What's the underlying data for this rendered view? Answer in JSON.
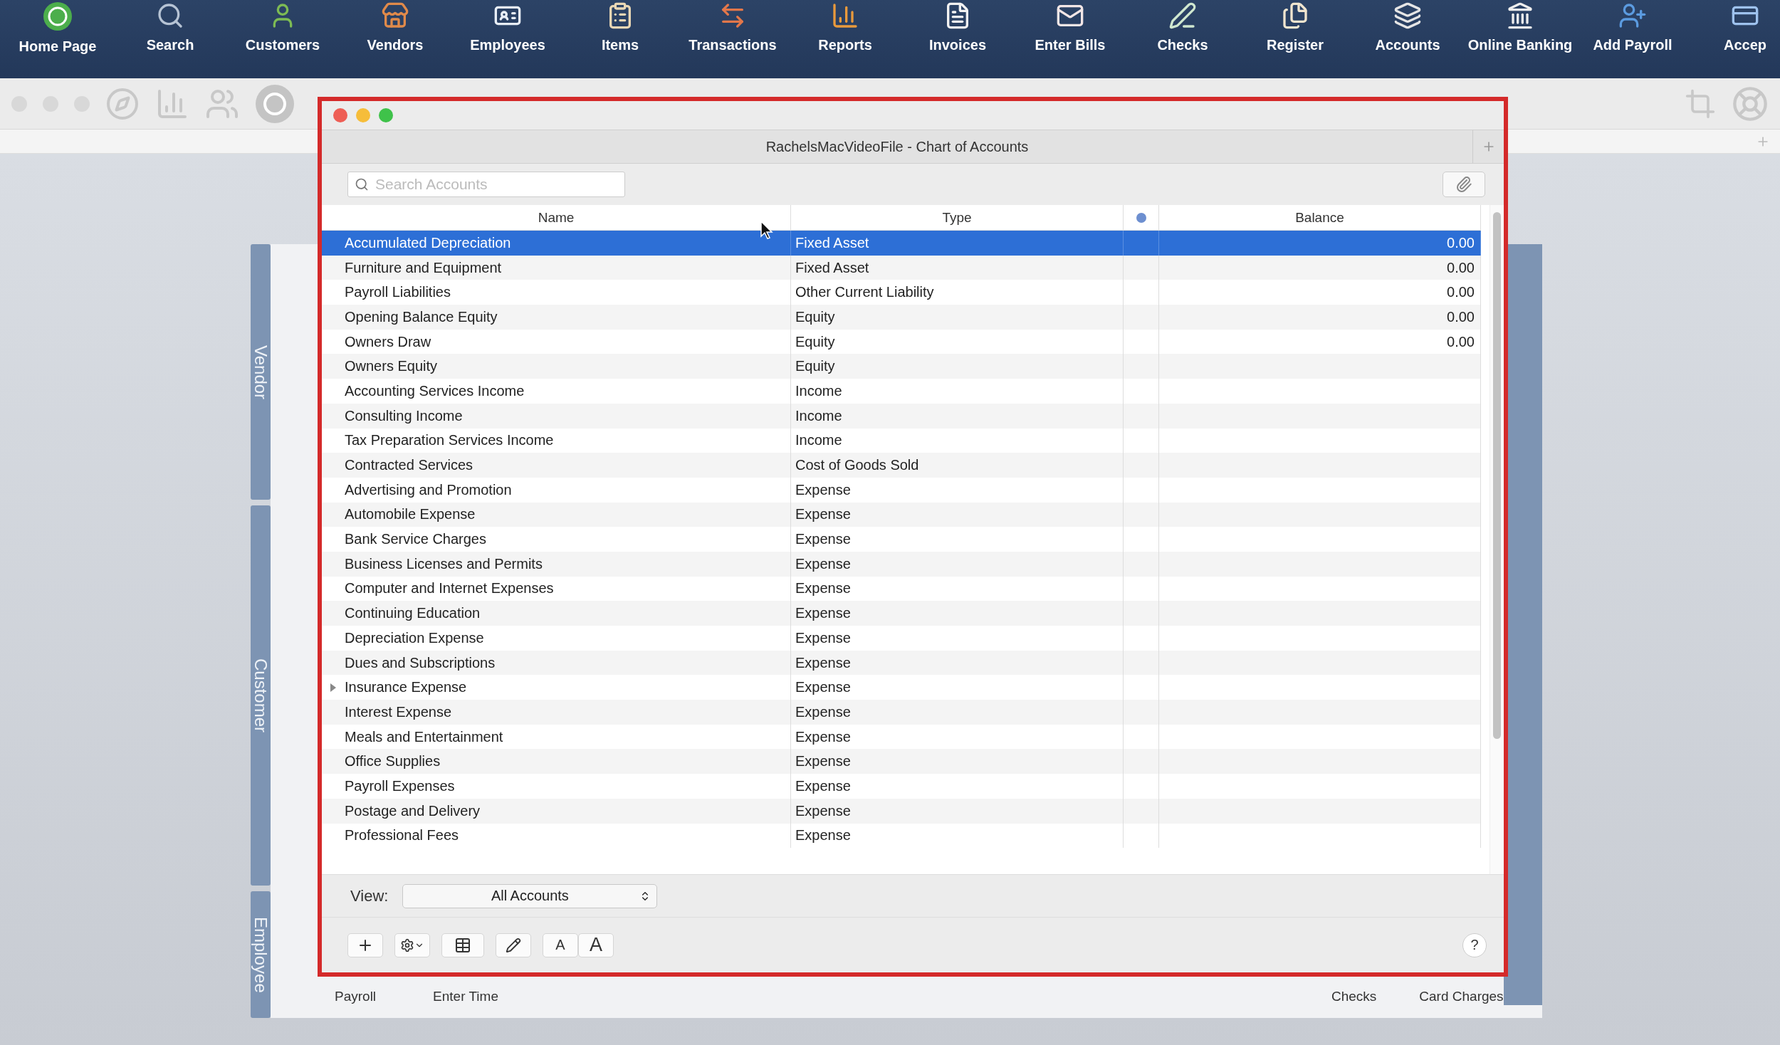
{
  "toolbar": [
    "Home Page",
    "Search",
    "Customers",
    "Vendors",
    "Employees",
    "Items",
    "Transactions",
    "Reports",
    "Invoices",
    "Enter Bills",
    "Checks",
    "Register",
    "Accounts",
    "Online Banking",
    "Add Payroll",
    "Accep"
  ],
  "side_tabs": [
    "Vendor",
    "Customer",
    "Employee"
  ],
  "shortcuts": [
    "Payroll",
    "Enter Time",
    "Checks",
    "Card Charges"
  ],
  "window": {
    "title": "RachelsMacVideoFile - Chart of Accounts",
    "search": {
      "placeholder": "Search Accounts"
    },
    "columns": [
      "Name",
      "Type",
      "Balance"
    ],
    "rows": [
      {
        "kind": "account",
        "name": "Accumulated Depreciation",
        "type": "Fixed Asset",
        "balance": "0.00",
        "selected": true
      },
      {
        "kind": "account",
        "name": "Furniture and Equipment",
        "type": "Fixed Asset",
        "balance": "0.00",
        "selected": false
      },
      {
        "kind": "account",
        "name": "Payroll Liabilities",
        "type": "Other Current Liability",
        "balance": "0.00",
        "selected": false
      },
      {
        "kind": "account",
        "name": "Opening Balance Equity",
        "type": "Equity",
        "balance": "0.00",
        "selected": false
      },
      {
        "kind": "account",
        "name": "Owners Draw",
        "type": "Equity",
        "balance": "0.00",
        "selected": false
      },
      {
        "kind": "account",
        "name": "Owners Equity",
        "type": "Equity",
        "selected": false
      },
      {
        "kind": "account",
        "name": "Accounting Services Income",
        "type": "Income",
        "selected": false
      },
      {
        "kind": "account",
        "name": "Consulting Income",
        "type": "Income",
        "selected": false
      },
      {
        "kind": "account",
        "name": "Tax Preparation Services Income",
        "type": "Income",
        "selected": false
      },
      {
        "kind": "account",
        "name": "Contracted Services",
        "type": "Cost of Goods Sold",
        "selected": false
      },
      {
        "kind": "account",
        "name": "Advertising and Promotion",
        "type": "Expense",
        "selected": false
      },
      {
        "kind": "account",
        "name": "Automobile Expense",
        "type": "Expense",
        "selected": false
      },
      {
        "kind": "account",
        "name": "Bank Service Charges",
        "type": "Expense",
        "selected": false
      },
      {
        "kind": "account",
        "name": "Business Licenses and Permits",
        "type": "Expense",
        "selected": false
      },
      {
        "kind": "account",
        "name": "Computer and Internet Expenses",
        "type": "Expense",
        "selected": false
      },
      {
        "kind": "account",
        "name": "Continuing Education",
        "type": "Expense",
        "selected": false
      },
      {
        "kind": "account",
        "name": "Depreciation Expense",
        "type": "Expense",
        "selected": false
      },
      {
        "kind": "account",
        "name": "Dues and Subscriptions",
        "type": "Expense",
        "selected": false
      },
      {
        "kind": "parent",
        "name": "Insurance Expense",
        "type": "Expense",
        "selected": false,
        "expanded": false
      },
      {
        "kind": "account",
        "name": "Interest Expense",
        "type": "Expense",
        "selected": false
      },
      {
        "kind": "account",
        "name": "Meals and Entertainment",
        "type": "Expense",
        "selected": false
      },
      {
        "kind": "account",
        "name": "Office Supplies",
        "type": "Expense",
        "selected": false
      },
      {
        "kind": "account",
        "name": "Payroll Expenses",
        "type": "Expense",
        "selected": false
      },
      {
        "kind": "account",
        "name": "Postage and Delivery",
        "type": "Expense",
        "selected": false
      },
      {
        "kind": "account",
        "name": "Professional Fees",
        "type": "Expense",
        "selected": false
      }
    ],
    "view": {
      "label": "View:",
      "value": "All Accounts"
    },
    "font_buttons": [
      "A",
      "A"
    ],
    "help": "?"
  }
}
